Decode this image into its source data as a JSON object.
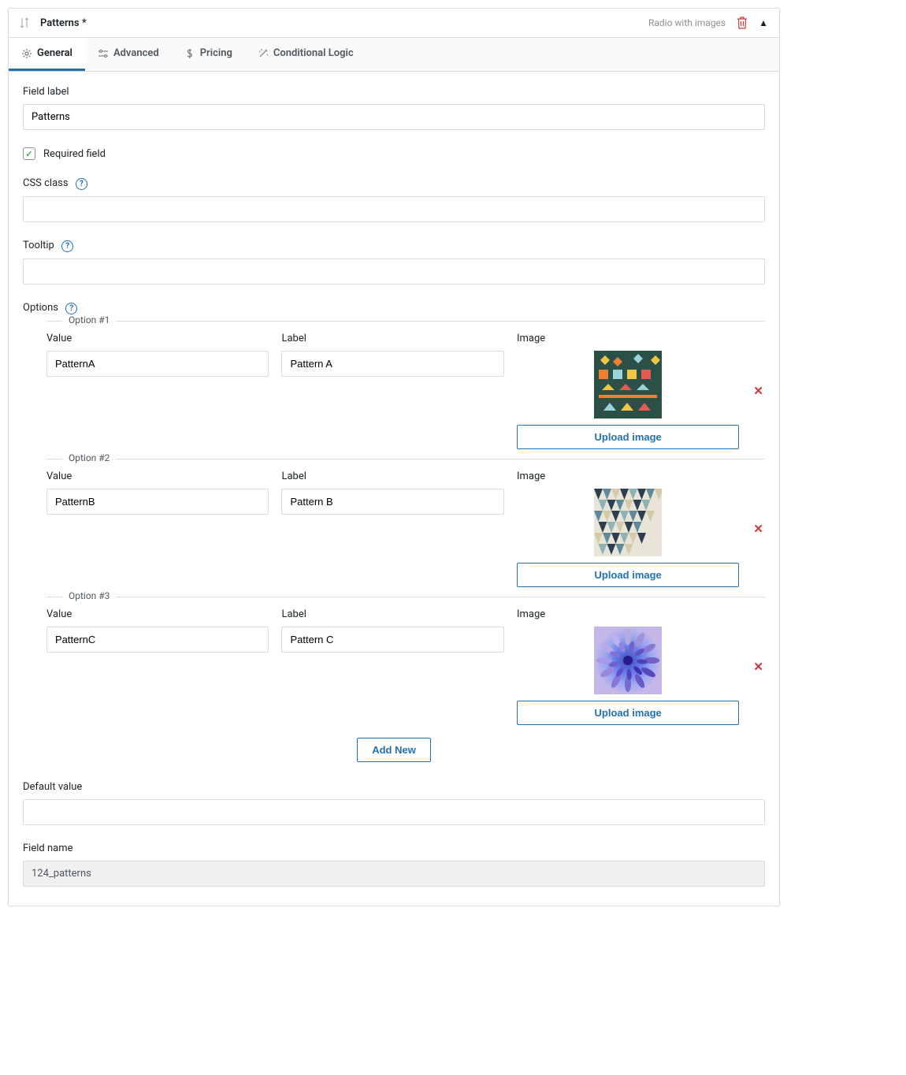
{
  "header": {
    "title": "Patterns *",
    "badge": "Radio with images"
  },
  "tabs": [
    {
      "label": "General",
      "active": true
    },
    {
      "label": "Advanced",
      "active": false
    },
    {
      "label": "Pricing",
      "active": false
    },
    {
      "label": "Conditional Logic",
      "active": false
    }
  ],
  "fields": {
    "field_label": {
      "label": "Field label",
      "value": "Patterns"
    },
    "required": {
      "label": "Required field",
      "checked": true
    },
    "css_class": {
      "label": "CSS class",
      "value": ""
    },
    "tooltip": {
      "label": "Tooltip",
      "value": ""
    },
    "options_label": "Options",
    "default_value": {
      "label": "Default value",
      "value": ""
    },
    "field_name": {
      "label": "Field name",
      "value": "124_patterns"
    }
  },
  "options": [
    {
      "legend": "Option #1",
      "value": "PatternA",
      "label": "Pattern A"
    },
    {
      "legend": "Option #2",
      "value": "PatternB",
      "label": "Pattern B"
    },
    {
      "legend": "Option #3",
      "value": "PatternC",
      "label": "Pattern C"
    }
  ],
  "col_labels": {
    "value": "Value",
    "label": "Label",
    "image": "Image"
  },
  "buttons": {
    "upload": "Upload image",
    "add_new": "Add New"
  }
}
